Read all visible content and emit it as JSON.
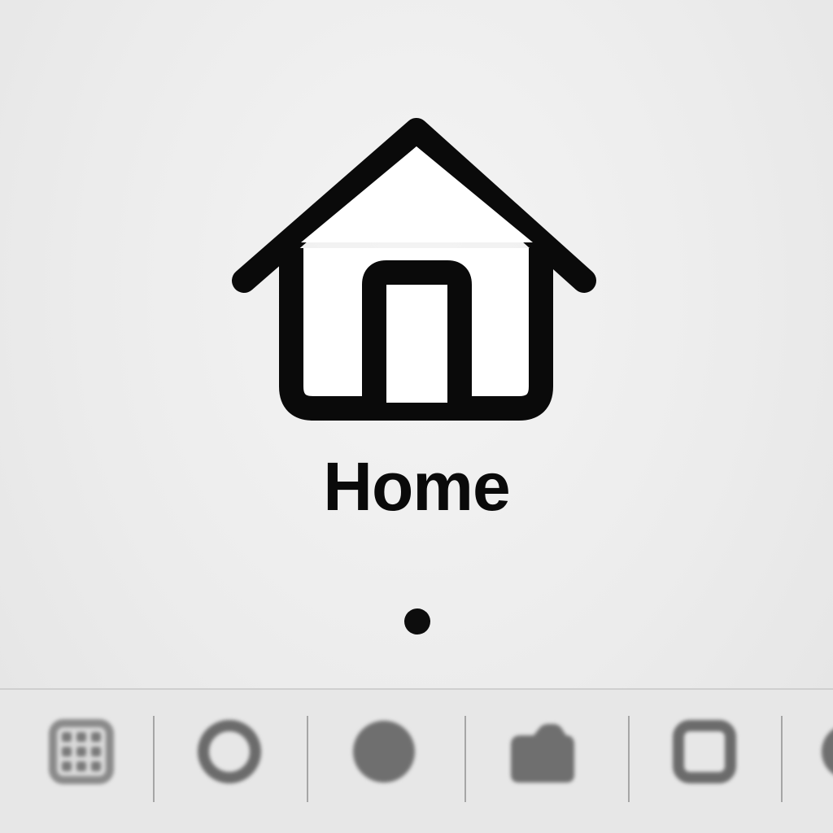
{
  "home": {
    "title": "Home",
    "icon": "house-icon"
  },
  "page_indicator": {
    "icon": "page-dot-icon"
  },
  "dock": {
    "items": [
      {
        "icon": "grid-apps-icon"
      },
      {
        "icon": "circle-outline-icon"
      },
      {
        "icon": "circle-filled-icon"
      },
      {
        "icon": "folder-icon"
      },
      {
        "icon": "square-outline-icon"
      },
      {
        "icon": "partial-icon"
      }
    ]
  },
  "colors": {
    "background": "#ececec",
    "foreground": "#0a0a0a",
    "dock_icon": "#6b6b6b",
    "dock_separator": "#8a8a8a"
  }
}
